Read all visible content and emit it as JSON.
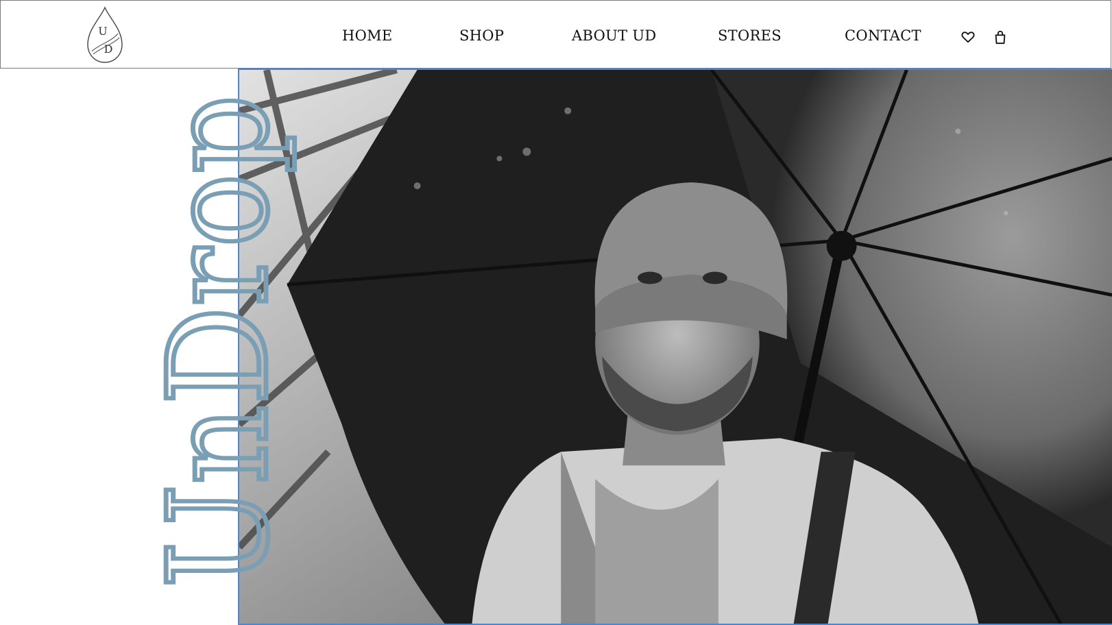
{
  "header": {
    "logo": {
      "letters": [
        "U",
        "D"
      ],
      "icon": "water-drop-logo-icon"
    },
    "nav": [
      {
        "label": "HOME"
      },
      {
        "label": "SHOP"
      },
      {
        "label": "ABOUT UD"
      },
      {
        "label": "STORES"
      },
      {
        "label": "CONTACT"
      }
    ],
    "icons": {
      "wishlist": "heart-icon",
      "cart": "shopping-bag-icon"
    }
  },
  "hero": {
    "brand_text": "UnDrop",
    "brand_color": "#7a9fb5",
    "frame_color": "#4a86d6",
    "photo": "man-with-umbrella-photo"
  }
}
